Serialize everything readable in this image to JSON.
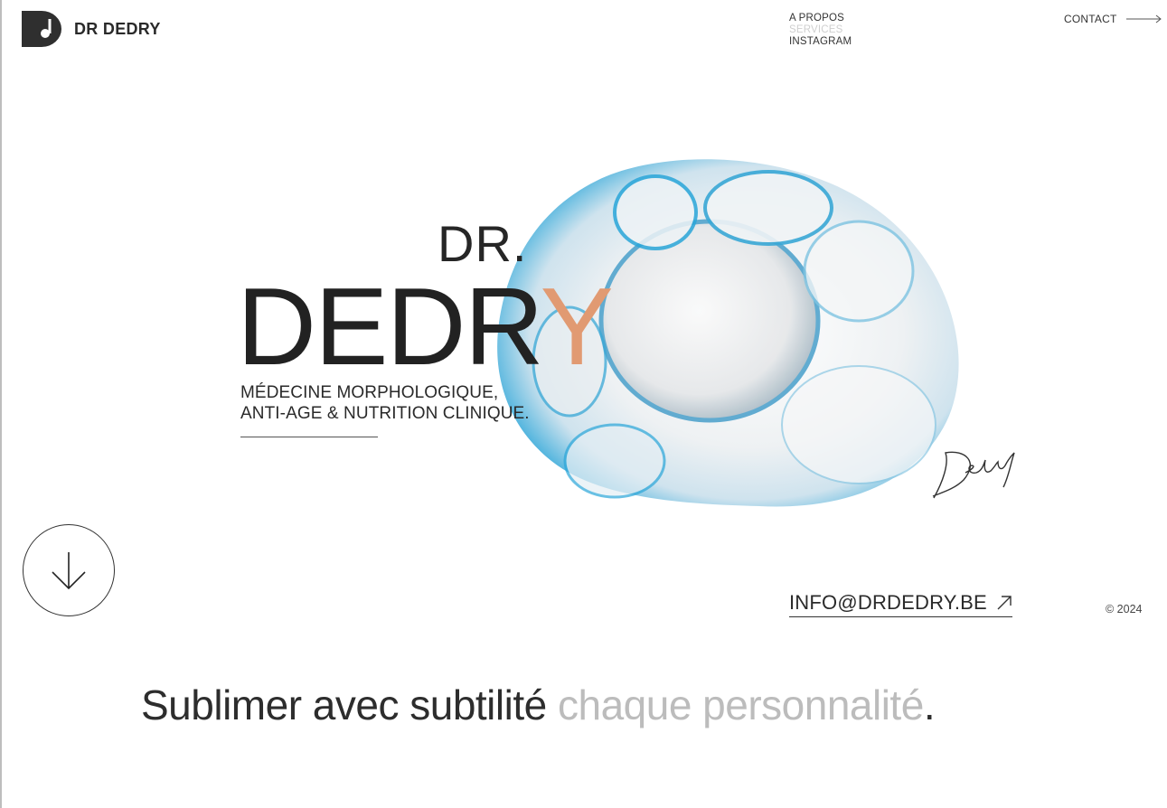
{
  "header": {
    "logo_text": "DR DEDRY",
    "nav": {
      "items": [
        "A PROPOS",
        "SERVICES",
        "INSTAGRAM"
      ]
    },
    "contact_label": "CONTACT"
  },
  "hero": {
    "title_line1": "DR.",
    "title_main": "DEDR",
    "title_accent_letter": "Y",
    "tagline_line1": "MÉDECINE MORPHOLOGIQUE,",
    "tagline_line2": "ANTI-AGE & NUTRITION CLINIQUE.",
    "signature_text": "Dedry"
  },
  "footer": {
    "email": "INFO@DRDEDRY.BE",
    "copyright": "© 2024"
  },
  "slogan": {
    "dark": "Sublimer avec subtilité ",
    "light": "chaque personnalité",
    "punct": "."
  },
  "colors": {
    "accent": "#e19a72",
    "blob_blue": "#2aa6d9",
    "text": "#222222",
    "muted": "#bcbcbc"
  },
  "icons": [
    "logo-mark-icon",
    "arrow-right-icon",
    "arrow-down-icon",
    "arrow-up-right-icon"
  ]
}
